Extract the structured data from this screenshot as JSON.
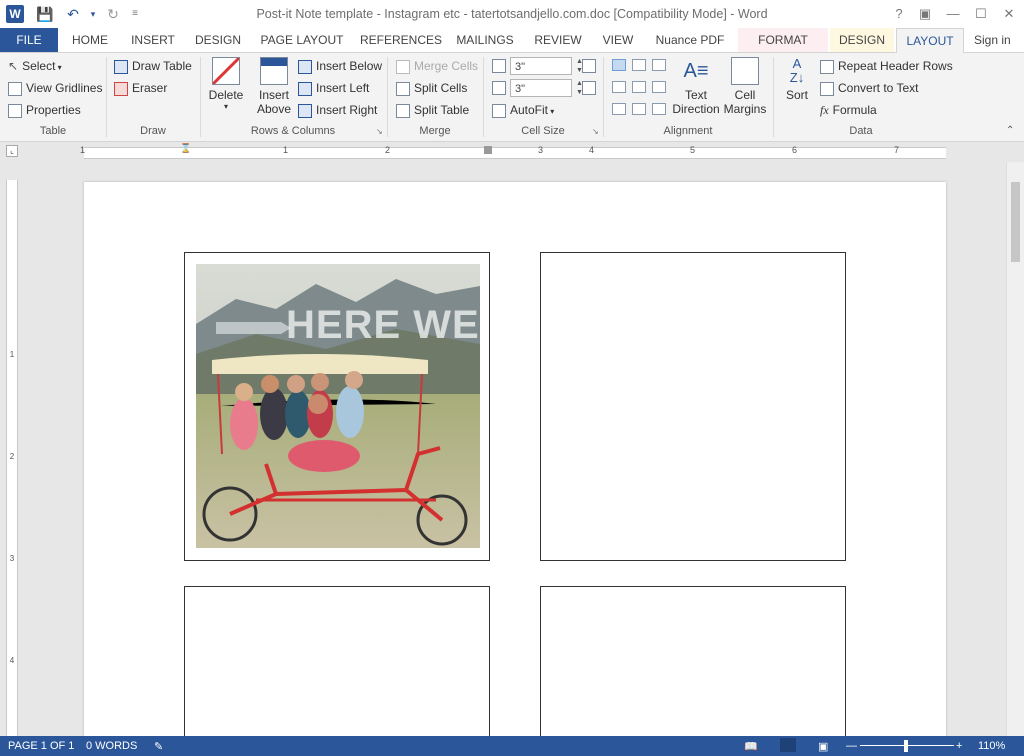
{
  "window": {
    "title": "Post-it Note template - Instagram etc - tatertotsandjello.com.doc [Compatibility Mode] - Word",
    "app_icon": "W",
    "help": "?",
    "sign_in": "Sign in"
  },
  "tabs": [
    {
      "label": "FILE"
    },
    {
      "label": "HOME"
    },
    {
      "label": "INSERT"
    },
    {
      "label": "DESIGN"
    },
    {
      "label": "PAGE LAYOUT"
    },
    {
      "label": "REFERENCES"
    },
    {
      "label": "MAILINGS"
    },
    {
      "label": "REVIEW"
    },
    {
      "label": "VIEW"
    },
    {
      "label": "Nuance PDF"
    },
    {
      "label": "FORMAT"
    },
    {
      "label": "DESIGN"
    },
    {
      "label": "LAYOUT"
    }
  ],
  "ribbon": {
    "table": {
      "label": "Table",
      "select": "Select",
      "view_gridlines": "View Gridlines",
      "properties": "Properties"
    },
    "draw": {
      "label": "Draw",
      "draw_table": "Draw Table",
      "eraser": "Eraser"
    },
    "rows_columns": {
      "label": "Rows & Columns",
      "delete": "Delete",
      "insert_above_1": "Insert",
      "insert_above_2": "Above",
      "insert_below": "Insert Below",
      "insert_left": "Insert Left",
      "insert_right": "Insert Right"
    },
    "merge": {
      "label": "Merge",
      "merge_cells": "Merge Cells",
      "split_cells": "Split Cells",
      "split_table": "Split Table"
    },
    "cell_size": {
      "label": "Cell Size",
      "height": "3\"",
      "width": "3\"",
      "autofit": "AutoFit"
    },
    "alignment": {
      "label": "Alignment",
      "text_direction_1": "Text",
      "text_direction_2": "Direction",
      "cell_margins_1": "Cell",
      "cell_margins_2": "Margins"
    },
    "data": {
      "label": "Data",
      "sort": "Sort",
      "repeat_header": "Repeat Header Rows",
      "convert": "Convert to Text",
      "formula": "Formula"
    }
  },
  "ruler": {
    "marks": [
      "1",
      "1",
      "2",
      "3",
      "4",
      "5",
      "6",
      "7"
    ],
    "vmarks": [
      "1",
      "2",
      "3",
      "4"
    ]
  },
  "document": {
    "photo_caption": "HERE WE GO!"
  },
  "status": {
    "page": "PAGE 1 OF 1",
    "words": "0 WORDS",
    "zoom": "110%"
  },
  "colors": {
    "accent": "#2b579a",
    "format_tab": "#fdeef2",
    "design_tab": "#fff8e0"
  }
}
